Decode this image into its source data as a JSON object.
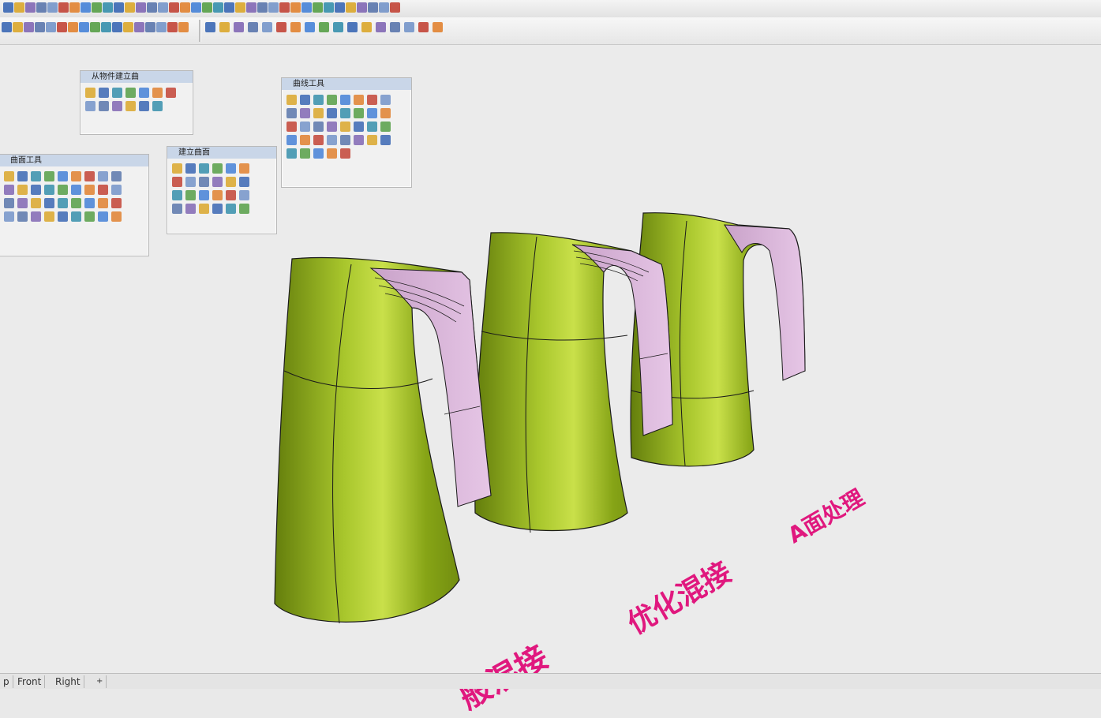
{
  "toolbars": {
    "row1_icon_count": 36,
    "row2_icon_count": 34
  },
  "palettes": {
    "solid_tools": {
      "title": "从物件建立曲",
      "icon_count": 13
    },
    "curve_tools": {
      "title": "曲线工具",
      "icon_count": 37
    },
    "surface_tools": {
      "title": "曲面工具",
      "icon_count": 36
    },
    "solid_surface": {
      "title": "建立曲面",
      "icon_count": 24
    }
  },
  "scene": {
    "labels": {
      "general": "般混接",
      "optimized": "优化混接",
      "surface_a": "A面处理"
    },
    "colors": {
      "body": "#8cac18",
      "handle": "#d6b2d6",
      "edge": "#1a1a1a",
      "label": "#e0187e"
    }
  },
  "statusbar": {
    "tabs": [
      "p",
      "Front",
      "Right"
    ],
    "add_tab_icon": "plus-icon"
  }
}
